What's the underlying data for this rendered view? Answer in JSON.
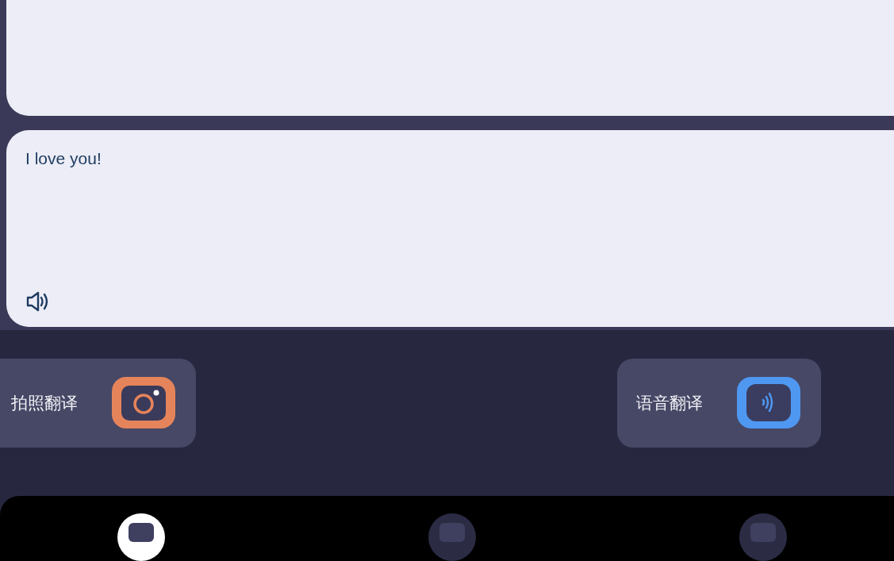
{
  "result_card": {
    "text": "I love you!"
  },
  "actions": [
    {
      "label": "拍照翻译",
      "kind": "camera"
    },
    {
      "label": "语音翻译",
      "kind": "voice"
    }
  ],
  "nav": [
    {
      "selected": true
    },
    {
      "selected": false
    },
    {
      "selected": false
    }
  ]
}
